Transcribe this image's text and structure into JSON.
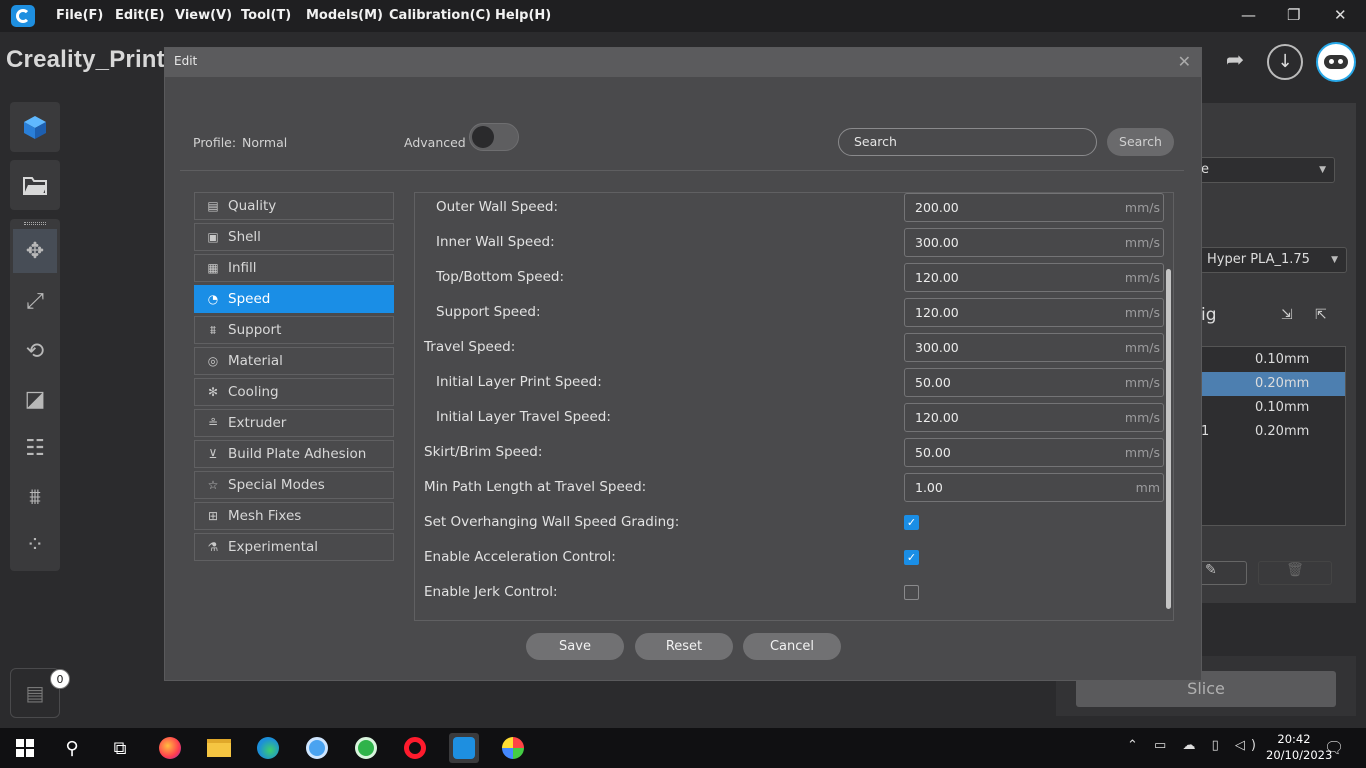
{
  "menubar": {
    "items": [
      "File(F)",
      "Edit(E)",
      "View(V)",
      "Tool(T)",
      "Models(M)",
      "Calibration(C)",
      "Help(H)"
    ],
    "window_controls": [
      "—",
      "❐",
      "✕"
    ]
  },
  "app": {
    "title": "Creality_Print"
  },
  "right_panel": {
    "preset_value": "e",
    "filament_value": "Hyper PLA_1.75",
    "config_label": "ig",
    "rows": [
      {
        "left": "",
        "value": "0.10mm"
      },
      {
        "left": "",
        "value": "0.20mm"
      },
      {
        "left": "",
        "value": "0.10mm"
      },
      {
        "left": "1",
        "value": "0.20mm"
      }
    ],
    "slice_label": "Slice"
  },
  "log": {
    "badge_count": "0"
  },
  "dialog": {
    "title": "Edit",
    "profile_label": "Profile:",
    "profile_value": "Normal",
    "advanced_label": "Advanced",
    "advanced_enabled": false,
    "search_placeholder": "Search",
    "search_button": "Search",
    "categories": [
      {
        "label": "Quality",
        "icon": "quality-icon",
        "active": false
      },
      {
        "label": "Shell",
        "icon": "shell-icon",
        "active": false
      },
      {
        "label": "Infill",
        "icon": "infill-icon",
        "active": false
      },
      {
        "label": "Speed",
        "icon": "speed-icon",
        "active": true
      },
      {
        "label": "Support",
        "icon": "support-icon",
        "active": false
      },
      {
        "label": "Material",
        "icon": "material-icon",
        "active": false
      },
      {
        "label": "Cooling",
        "icon": "fan-icon",
        "active": false
      },
      {
        "label": "Extruder",
        "icon": "extruder-icon",
        "active": false
      },
      {
        "label": "Build Plate Adhesion",
        "icon": "build-plate-icon",
        "active": false
      },
      {
        "label": "Special Modes",
        "icon": "star-icon",
        "active": false
      },
      {
        "label": "Mesh Fixes",
        "icon": "mesh-fix-icon",
        "active": false
      },
      {
        "label": "Experimental",
        "icon": "flask-icon",
        "active": false
      }
    ],
    "settings": [
      {
        "label": "Outer Wall Speed:",
        "indent": true,
        "type": "number",
        "value": "200.00",
        "unit": "mm/s"
      },
      {
        "label": "Inner Wall Speed:",
        "indent": true,
        "type": "number",
        "value": "300.00",
        "unit": "mm/s"
      },
      {
        "label": "Top/Bottom Speed:",
        "indent": true,
        "type": "number",
        "value": "120.00",
        "unit": "mm/s"
      },
      {
        "label": "Support Speed:",
        "indent": true,
        "type": "number",
        "value": "120.00",
        "unit": "mm/s"
      },
      {
        "label": "Travel Speed:",
        "indent": false,
        "type": "number",
        "value": "300.00",
        "unit": "mm/s"
      },
      {
        "label": "Initial Layer Print Speed:",
        "indent": true,
        "type": "number",
        "value": "50.00",
        "unit": "mm/s"
      },
      {
        "label": "Initial Layer Travel Speed:",
        "indent": true,
        "type": "number",
        "value": "120.00",
        "unit": "mm/s"
      },
      {
        "label": "Skirt/Brim Speed:",
        "indent": false,
        "type": "number",
        "value": "50.00",
        "unit": "mm/s"
      },
      {
        "label": "Min Path Length at Travel Speed:",
        "indent": false,
        "type": "number",
        "value": "1.00",
        "unit": "mm"
      },
      {
        "label": "Set Overhanging Wall Speed Grading:",
        "indent": false,
        "type": "checkbox",
        "checked": true
      },
      {
        "label": "Enable Acceleration Control:",
        "indent": false,
        "type": "checkbox",
        "checked": true
      },
      {
        "label": "Enable Jerk Control:",
        "indent": false,
        "type": "checkbox",
        "checked": false
      }
    ],
    "buttons": {
      "save": "Save",
      "reset": "Reset",
      "cancel": "Cancel"
    }
  },
  "taskbar": {
    "apps": [
      "windows-start-icon",
      "search-icon",
      "task-view-icon",
      "firefox-icon",
      "file-explorer-icon",
      "edge-icon",
      "camera-app-icon",
      "green-app-icon",
      "opera-icon",
      "creality-print-icon",
      "paint-app-icon"
    ],
    "clock_time": "20:42",
    "clock_date": "20/10/2023"
  },
  "colors": {
    "accent": "#1a8ee6",
    "dialog_bg": "#4a4a4c",
    "app_bg": "#2b2b2d"
  }
}
